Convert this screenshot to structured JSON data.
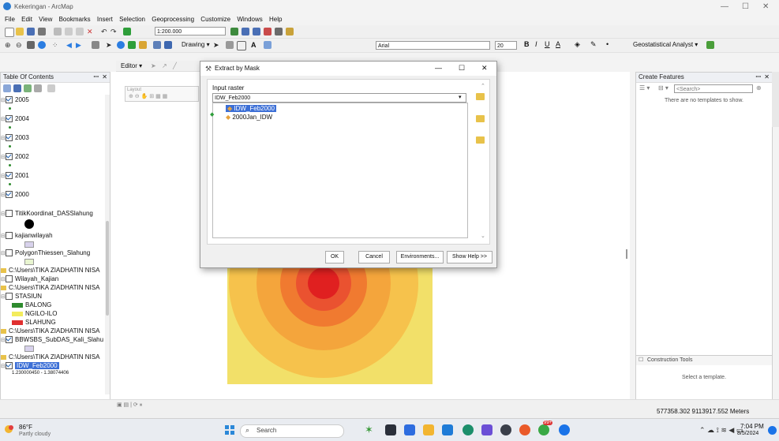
{
  "app": {
    "title": "Kekeringan - ArcMap"
  },
  "menu": [
    "File",
    "Edit",
    "View",
    "Bookmarks",
    "Insert",
    "Selection",
    "Geoprocessing",
    "Customize",
    "Windows",
    "Help"
  ],
  "toolbar": {
    "scale_value": "1:200.000",
    "drawing_label": "Drawing",
    "font_value": "Arial",
    "font_size_value": "20",
    "editor_label": "Editor",
    "geostat_label": "Geostatistical Analyst"
  },
  "toc": {
    "title": "Table Of Contents",
    "items": [
      {
        "label": "2005",
        "checked": true
      },
      {
        "label": "2004",
        "checked": true
      },
      {
        "label": "2003",
        "checked": true
      },
      {
        "label": "2002",
        "checked": true
      },
      {
        "label": "2001",
        "checked": true
      },
      {
        "label": "2000",
        "checked": true
      },
      {
        "label": "TitikKoordinat_DASSlahung",
        "checked": false
      },
      {
        "label": "kajianwilayah",
        "checked": false
      },
      {
        "label": "PolygonThiessen_Slahung",
        "checked": false
      },
      {
        "label": "C:\\Users\\TIKA ZIADHATIN NISA",
        "checked": null
      },
      {
        "label": "Wilayah_Kajian",
        "checked": false
      },
      {
        "label": "C:\\Users\\TIKA ZIADHATIN NISA",
        "checked": null
      },
      {
        "label": "STASIUN",
        "checked": false
      },
      {
        "label": "BALONG",
        "checked": null,
        "color": "#2e8b2e"
      },
      {
        "label": "NGILO-ILO",
        "checked": null,
        "color": "#f3ec5c"
      },
      {
        "label": "SLAHUNG",
        "checked": null,
        "color": "#e03030"
      },
      {
        "label": "C:\\Users\\TIKA ZIADHATIN NISA",
        "checked": null
      },
      {
        "label": "BBWSBS_SubDAS_Kali_Slahu",
        "checked": true
      },
      {
        "label": "C:\\Users\\TIKA ZIADHATIN NISA",
        "checked": null
      },
      {
        "label": "IDW_Feb2000",
        "checked": true,
        "selected": true
      }
    ],
    "range_text": "1.230000450 - 1.38074406"
  },
  "layout_tab": {
    "label": "Layout"
  },
  "dialog": {
    "title": "Extract by Mask",
    "input_raster_label": "Input raster",
    "input_raster_value": "IDW_Feb2000",
    "dropdown_options": [
      "IDW_Feb2000",
      "2000Jan_IDW"
    ],
    "ok_label": "OK",
    "cancel_label": "Cancel",
    "environments_label": "Environments...",
    "help_label": "Show Help >>",
    "minimize_label": "—",
    "maximize_label": "☐",
    "close_label": "✕"
  },
  "create_features": {
    "title": "Create Features",
    "search_placeholder": "<Search>",
    "no_templates_text": "There are no templates to show.",
    "construction_tools_label": "Construction Tools",
    "select_template_text": "Select a template."
  },
  "status": {
    "coordinates": "577358.302  9113917.552 Meters"
  },
  "taskbar": {
    "weather_temp": "86°F",
    "weather_desc": "Partly cloudy",
    "search_placeholder": "Search",
    "badge": "99+",
    "time": "7:04 PM",
    "date": "8/5/2024"
  },
  "colors": {
    "selection_blue": "#3c6fd6",
    "map_yellow": "#f2e069",
    "map_orange": "#f4a53c",
    "map_red": "#e02020"
  }
}
